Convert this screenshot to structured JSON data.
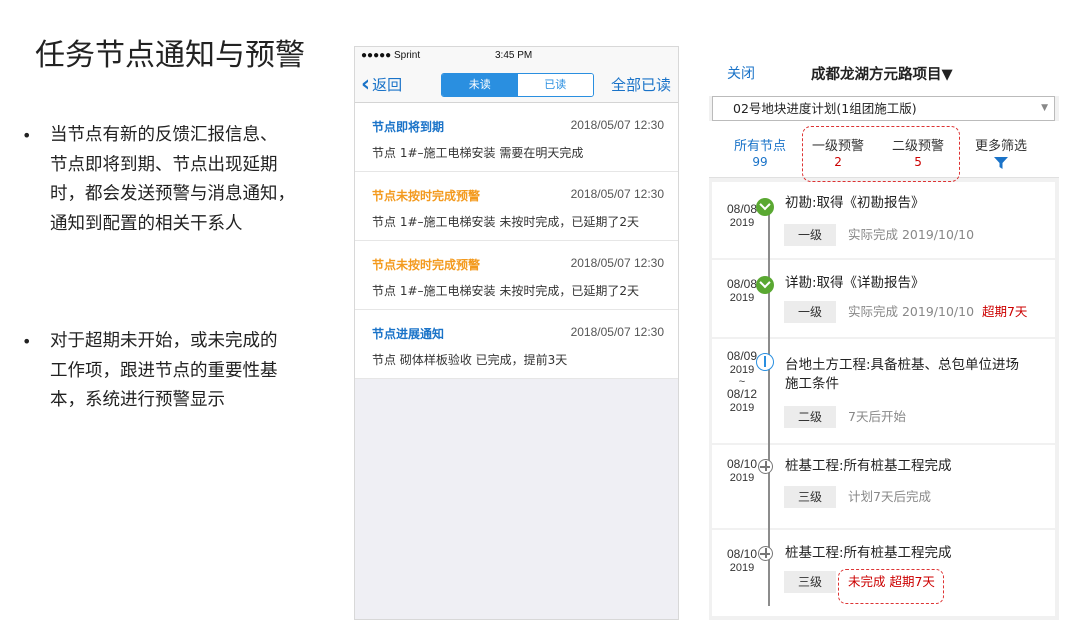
{
  "slide": {
    "title": "任务节点通知与预警",
    "bullets": [
      {
        "lines": [
          "当节点有新的反馈汇报信息、",
          "节点即将到期、节点出现延期",
          "时，都会发送预警与消息通知，",
          "通知到配置的相关干系人"
        ]
      },
      {
        "lines": [
          "对于超期未开始，或未完成的",
          "工作项，跟进节点的重要性基",
          "本，系统进行预警显示"
        ]
      }
    ],
    "bullet_symbol": "•"
  },
  "msg_app": {
    "status": {
      "carrier": "●●●●● Sprint",
      "time": "3:45 PM"
    },
    "back_label": "返回",
    "tabs": {
      "unread": "未读",
      "read": "已读"
    },
    "read_all": "全部已读",
    "messages": [
      {
        "title": "节点即将到期",
        "date": "2018/05/07  12:30",
        "body": "节点 1#–施工电梯安装 需要在明天完成",
        "color": "#1a73c8"
      },
      {
        "title": "节点未按时完成预警",
        "date": "2018/05/07  12:30",
        "body": "节点 1#–施工电梯安装 未按时完成，已延期了2天",
        "color": "#f39a1e"
      },
      {
        "title": "节点未按时完成预警",
        "date": "2018/05/07  12:30",
        "body": "节点 1#–施工电梯安装 未按时完成，已延期了2天",
        "color": "#f39a1e"
      },
      {
        "title": "节点进展通知",
        "date": "2018/05/07  12:30",
        "body": "节点 砌体样板验收 已完成，提前3天",
        "color": "#1a73c8"
      }
    ]
  },
  "node_app": {
    "close": "关闭",
    "project": "成都龙湖方元路项目▼",
    "plan_select": "02号地块进度计划(1组团施工版)",
    "filters": {
      "all": {
        "label": "所有节点",
        "value": "99"
      },
      "level1": {
        "label": "一级预警",
        "value": "2"
      },
      "level2": {
        "label": "二级预警",
        "value": "5"
      },
      "more": {
        "label": "更多筛选"
      }
    },
    "nodes": [
      {
        "date": "08/08",
        "year": "2019",
        "title": "初勘:取得《初勘报告》",
        "level": "一级",
        "status": "实际完成 2019/10/10",
        "warn": "",
        "icon": "check-icon"
      },
      {
        "date": "08/08",
        "year": "2019",
        "title": "详勘:取得《详勘报告》",
        "level": "一级",
        "status": "实际完成 2019/10/10",
        "warn": "超期7天",
        "icon": "check-icon"
      },
      {
        "date": "08/09",
        "year": "2019",
        "date_sep": "~",
        "date2": "08/12",
        "year2": "2019",
        "title": "台地土方工程:具备桩基、总包单位进场施工条件",
        "level": "二级",
        "status": "7天后开始",
        "warn": "",
        "icon": "in-progress-icon"
      },
      {
        "date": "08/10",
        "year": "2019",
        "title": "桩基工程:所有桩基工程完成",
        "level": "三级",
        "status": "计划7天后完成",
        "warn": "",
        "icon": "pending-icon"
      },
      {
        "date": "08/10",
        "year": "2019",
        "title": "桩基工程:所有桩基工程完成",
        "level": "三级",
        "status": "",
        "warn": "未完成 超期7天",
        "icon": "pending-icon"
      }
    ]
  }
}
